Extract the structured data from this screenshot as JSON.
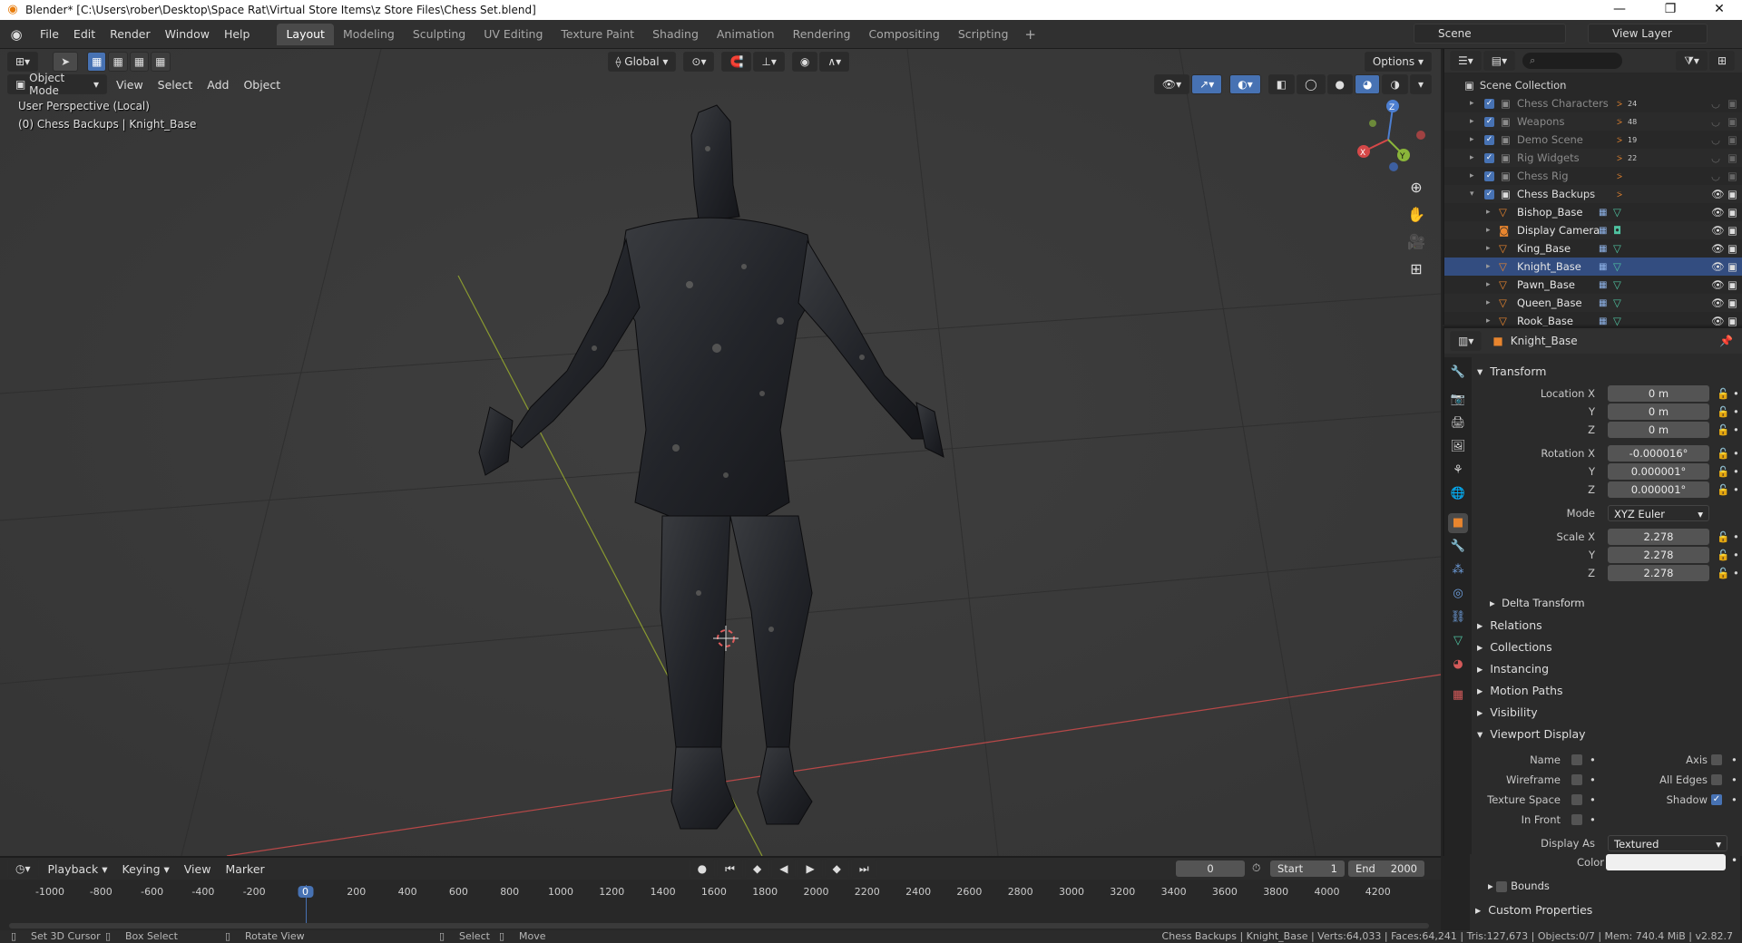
{
  "window": {
    "title": "Blender* [C:\\Users\\rober\\Desktop\\Space Rat\\Virtual Store Items\\z Store Files\\Chess Set.blend]",
    "controls": [
      "—",
      "❐",
      "✕"
    ]
  },
  "topbar": {
    "menus": [
      "File",
      "Edit",
      "Render",
      "Window",
      "Help"
    ],
    "workspaces": [
      "Layout",
      "Modeling",
      "Sculpting",
      "UV Editing",
      "Texture Paint",
      "Shading",
      "Animation",
      "Rendering",
      "Compositing",
      "Scripting"
    ],
    "active_workspace": "Layout",
    "scene": "Scene",
    "view_layer": "View Layer"
  },
  "viewport": {
    "mode": "Object Mode",
    "menus": [
      "View",
      "Select",
      "Add",
      "Object"
    ],
    "orientation": "Global",
    "options_label": "Options",
    "perspective_text": "User Perspective (Local)",
    "context_text": "(0) Chess Backups | Knight_Base",
    "gizmo": {
      "x": "X",
      "y": "Y",
      "z": "Z"
    }
  },
  "outliner": {
    "root": "Scene Collection",
    "collections": [
      {
        "name": "Chess Characters",
        "badge": "24",
        "dim": true
      },
      {
        "name": "Weapons",
        "badge": "48",
        "dim": true
      },
      {
        "name": "Demo Scene",
        "badge": "19",
        "dim": true
      },
      {
        "name": "Rig Widgets",
        "badge": "22",
        "dim": true
      },
      {
        "name": "Chess Rig",
        "badge": "",
        "dim": true
      },
      {
        "name": "Chess Backups",
        "badge": "",
        "dim": false
      }
    ],
    "objects": [
      "Bishop_Base",
      "Display Camera",
      "King_Base",
      "Knight_Base",
      "Pawn_Base",
      "Queen_Base",
      "Rook_Base"
    ],
    "selected": "Knight_Base"
  },
  "properties": {
    "object_name": "Knight_Base",
    "transform_label": "Transform",
    "location": {
      "label": "Location X",
      "x": "0 m",
      "y": "0 m",
      "z": "0 m"
    },
    "rotation": {
      "label": "Rotation X",
      "x": "-0.000016°",
      "y": "0.000001°",
      "z": "0.000001°"
    },
    "mode_label": "Mode",
    "mode_value": "XYZ Euler",
    "scale": {
      "label": "Scale X",
      "x": "2.278",
      "y": "2.278",
      "z": "2.278"
    },
    "axis_y": "Y",
    "axis_z": "Z",
    "delta_transform": "Delta Transform",
    "sections": [
      "Relations",
      "Collections",
      "Instancing",
      "Motion Paths",
      "Visibility"
    ],
    "viewport_display": "Viewport Display",
    "vd_rows": [
      {
        "left": "Name",
        "right": "Axis"
      },
      {
        "left": "Wireframe",
        "right": "All Edges"
      },
      {
        "left": "Texture Space",
        "right": "Shadow"
      },
      {
        "left": "In Front",
        "right": ""
      }
    ],
    "display_as_label": "Display As",
    "display_as_value": "Textured",
    "color_label": "Color",
    "bounds": "Bounds",
    "custom_properties": "Custom Properties"
  },
  "timeline": {
    "menus": [
      "Playback",
      "Keying",
      "View",
      "Marker"
    ],
    "current_frame": "0",
    "start_label": "Start",
    "start": "1",
    "end_label": "End",
    "end": "2000",
    "ticks": [
      "-1000",
      "-800",
      "-600",
      "-400",
      "-200",
      "0",
      "200",
      "400",
      "600",
      "800",
      "1000",
      "1200",
      "1400",
      "1600",
      "1800",
      "2000",
      "2200",
      "2400",
      "2600",
      "2800",
      "3000",
      "3200",
      "3400",
      "3600",
      "3800",
      "4000",
      "4200"
    ]
  },
  "statusbar": {
    "hints": [
      "Set 3D Cursor",
      "Box Select",
      "Rotate View",
      "Select",
      "Move"
    ],
    "stats": "Chess Backups | Knight_Base | Verts:64,033 | Faces:64,241 | Tris:127,673 | Objects:0/7 | Mem: 740.4 MiB | v2.82.7"
  },
  "colors": {
    "accent": "#4772b3",
    "selected_row": "#334d80",
    "object_orange": "#e8852e",
    "mesh_green": "#4fc2a0"
  }
}
